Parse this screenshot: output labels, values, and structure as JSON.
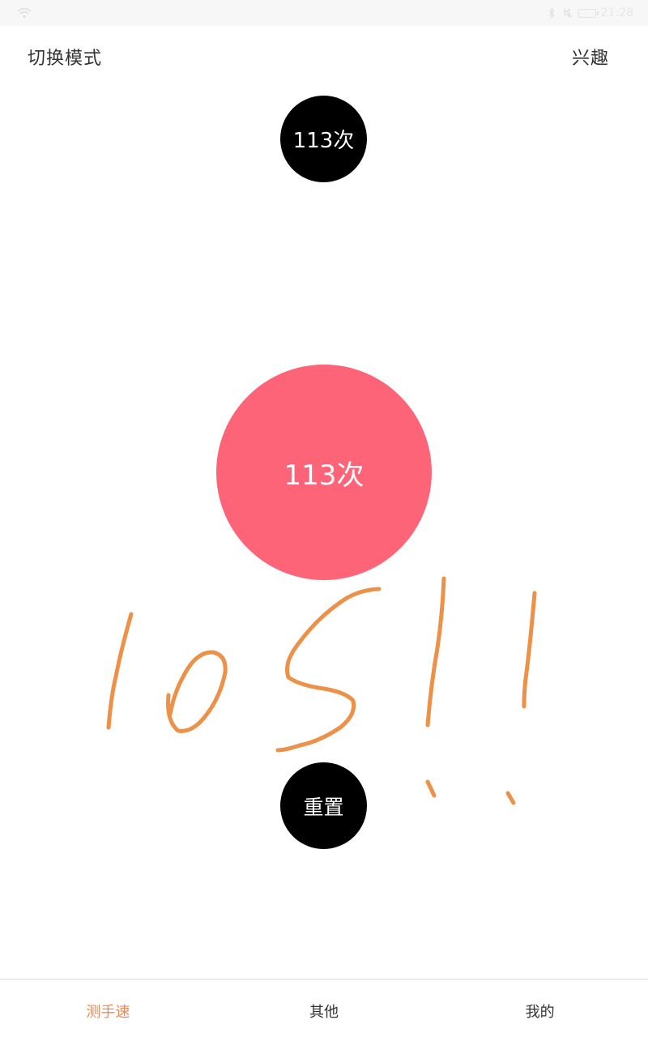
{
  "status_bar": {
    "time": "21:28",
    "icons": [
      "wifi-icon",
      "bluetooth-icon",
      "silent-icon",
      "battery-icon"
    ]
  },
  "header": {
    "left_label": "切换模式",
    "right_label": "兴趣"
  },
  "counter": {
    "badge_text": "113次",
    "tap_text": "113次"
  },
  "reset": {
    "label": "重置"
  },
  "annotation": {
    "handwritten_text": "105!!"
  },
  "bottom_nav": {
    "items": [
      {
        "label": "测手速",
        "active": true
      },
      {
        "label": "其他",
        "active": false
      },
      {
        "label": "我的",
        "active": false
      }
    ]
  },
  "colors": {
    "tap_circle": "#fe6478",
    "active_tab": "#ee8a5a",
    "scribble": "#ec9147"
  }
}
